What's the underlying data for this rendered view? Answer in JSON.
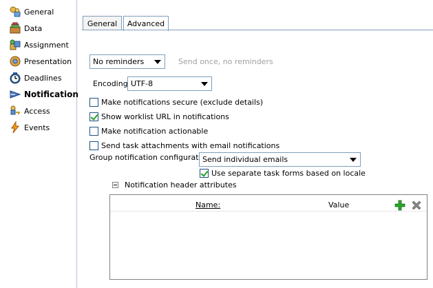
{
  "sidebar": {
    "items": [
      {
        "label": "General",
        "icon": "general-icon"
      },
      {
        "label": "Data",
        "icon": "data-icon"
      },
      {
        "label": "Assignment",
        "icon": "assignment-icon"
      },
      {
        "label": "Presentation",
        "icon": "presentation-icon"
      },
      {
        "label": "Deadlines",
        "icon": "deadlines-icon"
      },
      {
        "label": "Notification",
        "icon": "notification-icon",
        "selected": true
      },
      {
        "label": "Access",
        "icon": "access-icon"
      },
      {
        "label": "Events",
        "icon": "events-icon"
      }
    ]
  },
  "tabs": [
    {
      "label": "General"
    },
    {
      "label": "Advanced",
      "active": true
    }
  ],
  "reminders": {
    "selected": "No reminders",
    "hint": "Send once, no reminders"
  },
  "encoding": {
    "label": "Encoding:",
    "selected": "UTF-8"
  },
  "checkboxes": {
    "secure": {
      "label": "Make notifications secure (exclude details)",
      "checked": false
    },
    "worklist_url": {
      "label": "Show worklist URL in notifications",
      "checked": true
    },
    "actionable": {
      "label": "Make notification actionable",
      "checked": false
    },
    "attachments": {
      "label": "Send task attachments with email notifications",
      "checked": false
    },
    "separate_forms": {
      "label": "Use separate task forms based on locale",
      "checked": true
    }
  },
  "group_config": {
    "label": "Group notification configuration:",
    "selected": "Send individual emails"
  },
  "header_attributes": {
    "section_title": "Notification header attributes",
    "columns": {
      "name": "Name:",
      "value": "Value"
    },
    "rows": []
  },
  "colors": {
    "border": "#7f9db9",
    "hint_text": "#a0a0a0",
    "check_green": "#21a121",
    "add_green": "#2aa52a",
    "delete_gray": "#7a7a7a"
  }
}
